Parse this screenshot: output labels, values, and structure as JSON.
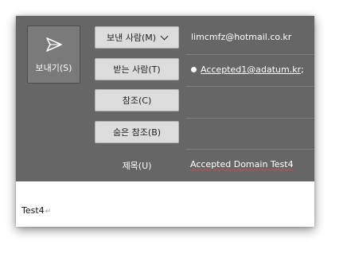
{
  "compose": {
    "send_label": "보내기(S)",
    "from_button": "보낸 사람(M)",
    "from_value": "limcmfz@hotmail.co.kr",
    "to_button": "받는 사람(T)",
    "to_value": "Accepted1@adatum.kr",
    "to_separator": ";",
    "cc_button": "참조(C)",
    "bcc_button": "숨은 참조(B)",
    "subject_label": "제목(U)",
    "subject_value": "Accepted Domain Test4",
    "body_text": "Test4",
    "paragraph_mark": "↵"
  },
  "icons": {
    "send": "send-paper-plane-icon",
    "from_dropdown": "chevron-down-icon",
    "recipient_status": "presence-dot-icon"
  },
  "colors": {
    "header_background": "#666666",
    "button_background": "#dcdcdc",
    "text_light": "#ffffff",
    "spellcheck_underline": "#d04a4a"
  }
}
